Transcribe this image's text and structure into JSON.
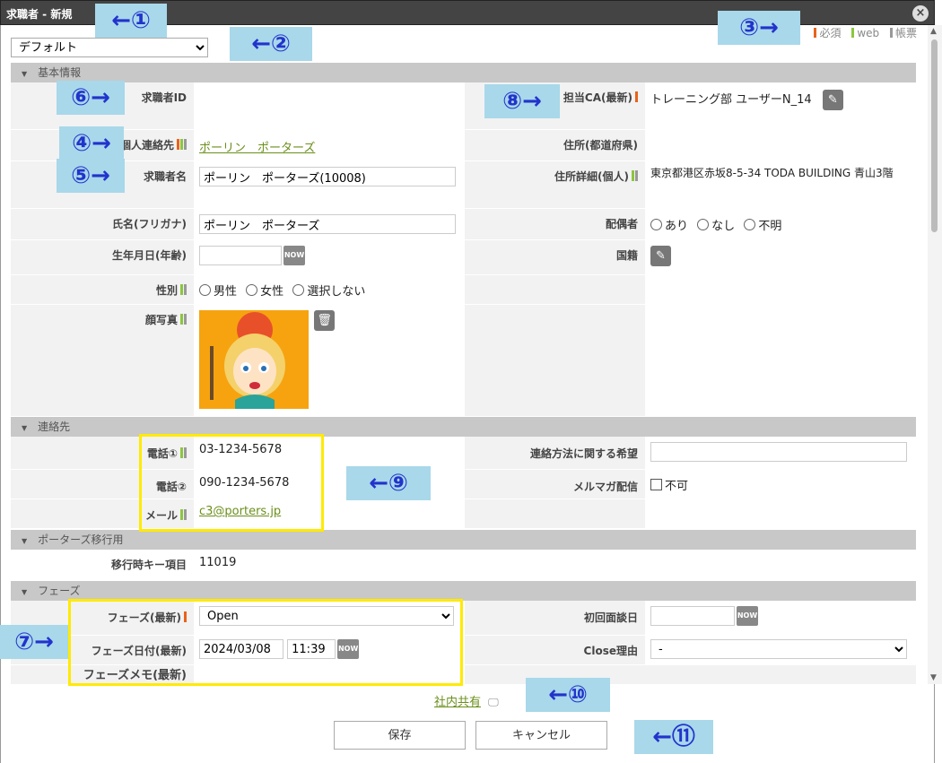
{
  "window": {
    "title": "求職者 - 新規"
  },
  "template": {
    "selected": "デフォルト"
  },
  "legend": {
    "required": "必須",
    "web": "web",
    "document": "帳票"
  },
  "sections": {
    "basic": "基本情報",
    "contact": "連絡先",
    "migration": "ポーターズ移行用",
    "phase": "フェーズ"
  },
  "basic": {
    "candidate_id_label": "求職者ID",
    "ca_label": "担当CA(最新)",
    "ca_value": "トレーニング部 ユーザーN_14",
    "personal_contact_label": "個人連絡先",
    "personal_contact_value": "ポーリン　ポーターズ",
    "prefecture_label": "住所(都道府県)",
    "candidate_name_label": "求職者名",
    "candidate_name_value": "ポーリン　ポーターズ(10008)",
    "address_detail_label": "住所詳細(個人)",
    "address_detail_value": "東京都港区赤坂8-5-34 TODA BUILDING 青山3階",
    "kana_label": "氏名(フリガナ)",
    "kana_value": "ポーリン　ポーターズ",
    "spouse_label": "配偶者",
    "spouse_options": [
      "あり",
      "なし",
      "不明"
    ],
    "birthday_label": "生年月日(年齢)",
    "now": "NOW",
    "nationality_label": "国籍",
    "gender_label": "性別",
    "gender_options": [
      "男性",
      "女性",
      "選択しない"
    ],
    "photo_label": "顔写真"
  },
  "contact": {
    "phone1_label": "電話①",
    "phone1_value": "03-1234-5678",
    "phone2_label": "電話②",
    "phone2_value": "090-1234-5678",
    "email_label": "メール",
    "email_value": "c3@porters.jp",
    "method_label": "連絡方法に関する希望",
    "newsletter_label": "メルマガ配信",
    "newsletter_option": "不可"
  },
  "migration": {
    "key_label": "移行時キー項目",
    "key_value": "11019"
  },
  "phase": {
    "phase_label": "フェーズ(最新)",
    "phase_value": "Open",
    "phase_date_label": "フェーズ日付(最新)",
    "phase_date_value": "2024/03/08",
    "phase_time_value": "11:39",
    "first_interview_label": "初回面談日",
    "close_reason_label": "Close理由",
    "close_reason_value": "-",
    "memo_label": "フェーズメモ(最新)"
  },
  "footer": {
    "share_link": "社内共有",
    "save": "保存",
    "cancel": "キャンセル"
  },
  "callouts": [
    "←①",
    "←②",
    "③→",
    "④→",
    "⑤→",
    "⑥→",
    "⑦→",
    "⑧→",
    "←⑨",
    "←⑩",
    "←⑪"
  ],
  "icons": {
    "close": "close-icon",
    "edit": "pencil-icon",
    "trash": "trash-icon",
    "share": "monitor-icon"
  }
}
